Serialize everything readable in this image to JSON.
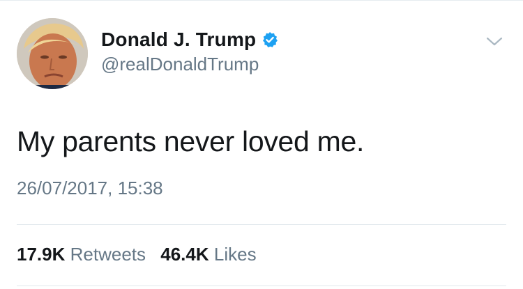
{
  "author": {
    "display_name": "Donald J. Trump",
    "handle": "@realDonaldTrump",
    "verified": true,
    "avatar_icon": "profile-photo"
  },
  "tweet": {
    "text": "My parents never loved me.",
    "timestamp": "26/07/2017, 15:38"
  },
  "stats": {
    "retweets_count": "17.9K",
    "retweets_label": "Retweets",
    "likes_count": "46.4K",
    "likes_label": "Likes"
  },
  "colors": {
    "primary_text": "#14171a",
    "secondary_text": "#657786",
    "verified_blue": "#1da1f2",
    "divider": "#e1e8ed"
  },
  "icons": {
    "verified": "verified-badge-icon",
    "menu": "chevron-down-icon"
  }
}
